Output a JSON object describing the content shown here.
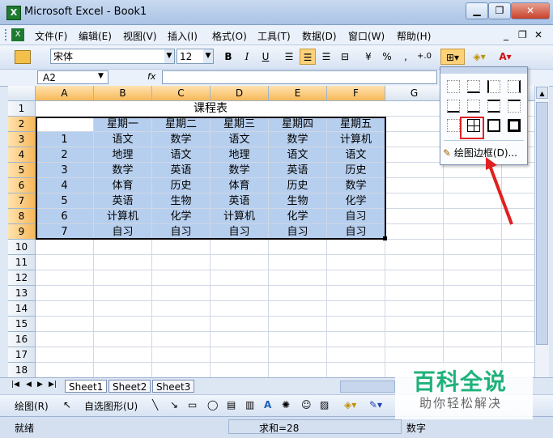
{
  "window": {
    "title": "Microsoft Excel - Book1",
    "app_icon": "X",
    "minimize": "▁",
    "restore": "❐",
    "close": "✕"
  },
  "menu": {
    "items": [
      "文件(F)",
      "编辑(E)",
      "视图(V)",
      "插入(I)",
      "格式(O)",
      "工具(T)",
      "数据(D)",
      "窗口(W)",
      "帮助(H)"
    ],
    "doc_min": "_",
    "doc_restore": "❐",
    "doc_close": "✕"
  },
  "toolbar": {
    "font_name": "宋体",
    "font_size": "12",
    "bold": "B",
    "italic": "I",
    "underline": "U",
    "percent": "%",
    "comma": ",",
    "increase_decimal": "+.0"
  },
  "formula_bar": {
    "name_box": "A2",
    "fx": "fx",
    "value": ""
  },
  "sheet": {
    "columns": [
      "A",
      "B",
      "C",
      "D",
      "E",
      "F",
      "G"
    ],
    "rows": [
      "1",
      "2",
      "3",
      "4",
      "5",
      "6",
      "7",
      "8",
      "9",
      "10",
      "11",
      "12",
      "13",
      "14",
      "15",
      "16",
      "17",
      "18"
    ],
    "title": "课程表",
    "header": [
      "",
      "星期一",
      "星期二",
      "星期三",
      "星期四",
      "星期五"
    ],
    "data": [
      [
        "1",
        "语文",
        "数学",
        "语文",
        "数学",
        "计算机"
      ],
      [
        "2",
        "地理",
        "语文",
        "地理",
        "语文",
        "语文"
      ],
      [
        "3",
        "数学",
        "英语",
        "数学",
        "英语",
        "历史"
      ],
      [
        "4",
        "体育",
        "历史",
        "体育",
        "历史",
        "数学"
      ],
      [
        "5",
        "英语",
        "生物",
        "英语",
        "生物",
        "化学"
      ],
      [
        "6",
        "计算机",
        "化学",
        "计算机",
        "化学",
        "自习"
      ],
      [
        "7",
        "自习",
        "自习",
        "自习",
        "自习",
        "自习"
      ]
    ]
  },
  "tabs": [
    "Sheet1",
    "Sheet2",
    "Sheet3"
  ],
  "drawing_toolbar": {
    "draw": "绘图(R)",
    "autoshapes": "自选图形(U)"
  },
  "status": {
    "ready": "就绪",
    "sum": "求和=28",
    "num": "数字"
  },
  "border_dropdown": {
    "draw_borders": "绘图边框(D)..."
  },
  "watermark": {
    "title": "百科全说",
    "subtitle": "助你轻松解决"
  },
  "colors": {
    "selection": "#b7cfee",
    "highlight": "#e02020",
    "watermark_green": "#1fb27b"
  }
}
